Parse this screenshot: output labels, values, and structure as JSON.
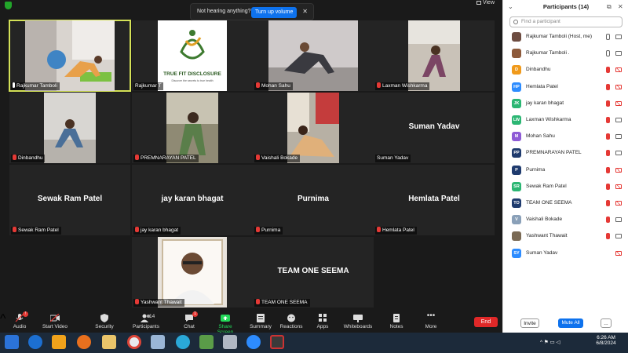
{
  "toast": {
    "message": "Not hearing anything?",
    "button": "Turn up volume"
  },
  "view_label": "View",
  "tiles": [
    {
      "label": "Rajkumar Tamboli",
      "name": "",
      "video": true
    },
    {
      "label": "Rajkumar T",
      "name": "",
      "video": true
    },
    {
      "label": "Mohan Sahu",
      "name": "",
      "video": true
    },
    {
      "label": "Laxman Wishkarma",
      "name": "",
      "video": true
    },
    {
      "label": "Dinbandhu",
      "name": "",
      "video": true
    },
    {
      "label": "PREMNARAYAN PATEL",
      "name": "",
      "video": true
    },
    {
      "label": "Vaishali Bokade",
      "name": "",
      "video": true
    },
    {
      "label": "Suman Yadav",
      "name": "Suman Yadav",
      "video": false
    },
    {
      "label": "Sewak Ram Patel",
      "name": "Sewak Ram Patel",
      "video": false
    },
    {
      "label": "jay karan bhagat",
      "name": "jay karan bhagat",
      "video": false
    },
    {
      "label": "Purnima",
      "name": "Purnima",
      "video": false
    },
    {
      "label": "Hemlata Patel",
      "name": "Hemlata Patel",
      "video": false
    },
    {
      "label": "Yashwant Thawait",
      "name": "",
      "video": true
    },
    {
      "label": "TEAM ONE SEEMA",
      "name": "TEAM ONE SEEMA",
      "video": false
    }
  ],
  "logo": {
    "title": "TRUE FIT DISCLOSURE",
    "tagline": "Discover the secrets to true health"
  },
  "toolbar": {
    "audio": "Audio",
    "video": "Start Video",
    "security": "Security",
    "participants": "Participants",
    "participants_count": "14",
    "chat": "Chat",
    "chat_badge": "1",
    "audio_badge": "!",
    "share": "Share Screen",
    "summary": "Summary",
    "reactions": "Reactions",
    "apps": "Apps",
    "whiteboards": "Whiteboards",
    "notes": "Notes",
    "more": "More",
    "end": "End"
  },
  "panel": {
    "title": "Participants (14)",
    "search_placeholder": "Find a participant",
    "invite": "Invite",
    "mute_all": "Mute All",
    "more": "...",
    "participants": [
      {
        "name": "Rajkumar Tamboli (Host, me)",
        "initials": "",
        "color": "#6d4c41",
        "photo": true,
        "mic": "on",
        "cam": "on"
      },
      {
        "name": "Rajkumar Tamboli .",
        "initials": "",
        "color": "#8d5a3b",
        "photo": true,
        "mic": "on",
        "cam": "on"
      },
      {
        "name": "Dinbandhu",
        "initials": "D",
        "color": "#f09a1b",
        "photo": false,
        "mic": "off",
        "cam": "off"
      },
      {
        "name": "Hemlata Patel",
        "initials": "HP",
        "color": "#2d8cff",
        "photo": false,
        "mic": "off",
        "cam": "off"
      },
      {
        "name": "jay karan bhagat",
        "initials": "JK",
        "color": "#2bb673",
        "photo": false,
        "mic": "off",
        "cam": "off"
      },
      {
        "name": "Laxman Wishkarma",
        "initials": "LW",
        "color": "#2bb673",
        "photo": false,
        "mic": "off",
        "cam": "on"
      },
      {
        "name": "Mohan Sahu",
        "initials": "M",
        "color": "#8e5bd6",
        "photo": false,
        "mic": "off",
        "cam": "on"
      },
      {
        "name": "PREMNARAYAN PATEL",
        "initials": "PP",
        "color": "#1f3b6e",
        "photo": false,
        "mic": "off",
        "cam": "on"
      },
      {
        "name": "Purnima",
        "initials": "P",
        "color": "#1f3b6e",
        "photo": false,
        "mic": "off",
        "cam": "off"
      },
      {
        "name": "Sewak Ram Patel",
        "initials": "SR",
        "color": "#2bb673",
        "photo": false,
        "mic": "off",
        "cam": "off"
      },
      {
        "name": "TEAM ONE SEEMA",
        "initials": "TO",
        "color": "#1f3b6e",
        "photo": false,
        "mic": "off",
        "cam": "off"
      },
      {
        "name": "Vaishali Bokade",
        "initials": "V",
        "color": "#8aa0b8",
        "photo": false,
        "mic": "off",
        "cam": "on"
      },
      {
        "name": "Yashwant Thawait",
        "initials": "",
        "color": "#7a6a55",
        "photo": true,
        "mic": "off",
        "cam": "on"
      },
      {
        "name": "Suman Yadav",
        "initials": "SY",
        "color": "#2d8cff",
        "photo": false,
        "mic": "",
        "cam": "off"
      }
    ]
  },
  "taskbar": {
    "time": "6:26 AM",
    "date": "6/8/2024"
  }
}
